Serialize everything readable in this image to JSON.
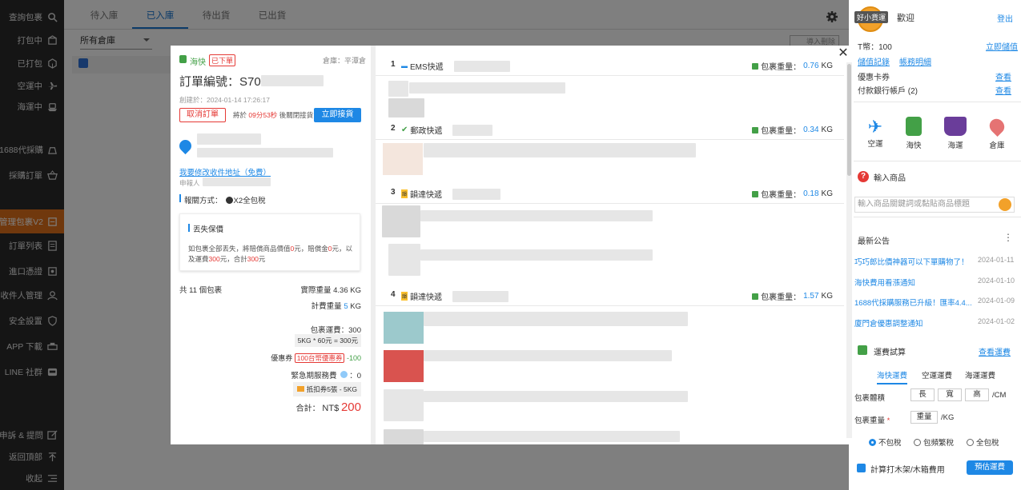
{
  "sidebar": {
    "items": [
      {
        "label": "查詢包裹",
        "icon": "search-icon"
      },
      {
        "label": "打包中",
        "icon": "box-icon"
      },
      {
        "label": "已打包",
        "icon": "package-icon"
      },
      {
        "label": "空運中",
        "icon": "plane-icon"
      },
      {
        "label": "海運中",
        "icon": "ship-icon"
      },
      {
        "label": "1688代採購",
        "icon": "shopping-icon"
      },
      {
        "label": "採購訂單",
        "icon": "basket-icon"
      },
      {
        "label": "管理包裹V2",
        "icon": "manage-icon"
      },
      {
        "label": "訂單列表",
        "icon": "list-icon"
      },
      {
        "label": "進口憑證",
        "icon": "certificate-icon"
      },
      {
        "label": "收件人管理",
        "icon": "user-icon"
      },
      {
        "label": "安全設置",
        "icon": "shield-icon"
      },
      {
        "label": "APP 下載",
        "icon": "printer-icon"
      },
      {
        "label": "LINE 社群",
        "icon": "line-icon"
      },
      {
        "label": "申訴 & 提問",
        "icon": "edit-icon"
      },
      {
        "label": "返回頂部",
        "icon": "top-arrow-icon"
      },
      {
        "label": "收起",
        "icon": "collapse-icon"
      }
    ]
  },
  "main": {
    "tabs": [
      "待入庫",
      "已入庫",
      "待出貨",
      "已出貨"
    ],
    "warehouse_select": "所有倉庫",
    "right_button": "導入刪除"
  },
  "right_panel": {
    "greeting": "歡迎",
    "badge": "好小貨運",
    "logout": "登出",
    "t_coin_label": "T幣：100",
    "t_coin_link": "立即儲值",
    "links": [
      "儲值記錄",
      "帳務明細"
    ],
    "coupon": "優惠卡券",
    "coupon_link": "查看",
    "bank": "付款銀行帳戶 (2)",
    "bank_link": "查看",
    "modes": [
      "空運",
      "海快",
      "海運",
      "倉庫"
    ],
    "help_title": "輸入商品",
    "search_placeholder": "輸入商品關鍵詞或黏貼商品標題",
    "news_title": "最新公告",
    "news": [
      {
        "title": "巧巧郎比價神器可以下單購物了！",
        "date": "2024-01-11"
      },
      {
        "title": "海快費用看漲通知",
        "date": "2024-01-10"
      },
      {
        "title": "1688代採購服務已升級！匯率4.4...",
        "date": "2024-01-09"
      },
      {
        "title": "廈門倉優惠調整通知",
        "date": "2024-01-02"
      }
    ],
    "calc_title": "運費試算",
    "calc_link": "查看運費",
    "calc_tabs": [
      "海快運費",
      "空運運費",
      "海運運費"
    ],
    "size_label": "包裹體積",
    "size_fields": [
      "長",
      "寬",
      "高"
    ],
    "size_unit": "/CM",
    "weight_label": "包裹重量",
    "weight_field": "重量",
    "weight_unit": "/KG",
    "tax_options": [
      "不包稅",
      "包頻繁稅",
      "全包稅"
    ],
    "wood_label": "計算打木架/木箱費用",
    "estimate_button": "預估運費"
  },
  "modal": {
    "mode": "海快",
    "status_badge": "已下單",
    "warehouse": "倉庫：平潭倉",
    "order_no_label": "訂單編號：",
    "order_no": "S703",
    "created": "創建於：2024-01-14 17:26:17",
    "cancel_button": "取消訂單",
    "countdown_prefix": "將於",
    "countdown": "09分53秒",
    "countdown_suffix": "後關閉接貨",
    "receive_button": "立即接貨",
    "edit_address": "我要修改收件地址（免費）",
    "applicant": "申報人",
    "customs_label": "報關方式：",
    "customs_value": "X2全包稅",
    "insurance_title": "丟失保價",
    "insurance_line1_a": "如包裹全部丟失，將賠償商品價值",
    "insurance_line1_b": "0",
    "insurance_line1_c": "元，賠償金",
    "insurance_line1_d": "0",
    "insurance_line1_e": "元，以",
    "insurance_line2_a": "及運費",
    "insurance_line2_b": "300",
    "insurance_line2_c": "元，合計",
    "insurance_line2_d": "300",
    "insurance_line2_e": "元",
    "pkg_count": "共 11 個包裹",
    "actual_weight": "實際重量 4.36 KG",
    "charge_weight_label": "計費重量",
    "charge_weight_value": "5",
    "charge_weight_unit": "KG",
    "shipping_fee": "包裹運費：300",
    "shipping_formula": "5KG * 60元 = 300元",
    "coupon_label": "優惠券",
    "coupon_tag": "100台幣優惠券",
    "coupon_value": "-100",
    "fast_fee": "緊急期服務費",
    "fast_fee_value": "：0",
    "voucher": "抵扣券5張 - 5KG",
    "total_label": "合計：",
    "total_currency": "NT$",
    "total_value": "200",
    "packages": [
      {
        "n": "1",
        "carrier": "EMS快遞",
        "weight_label": "包裹重量：",
        "weight": "0.76",
        "unit": "KG"
      },
      {
        "n": "2",
        "carrier": "郵政快遞",
        "weight_label": "包裹重量：",
        "weight": "0.34",
        "unit": "KG"
      },
      {
        "n": "3",
        "carrier": "韻達快遞",
        "weight_label": "包裹重量：",
        "weight": "0.18",
        "unit": "KG"
      },
      {
        "n": "4",
        "carrier": "韻達快遞",
        "weight_label": "包裹重量：",
        "weight": "1.57",
        "unit": "KG"
      }
    ]
  },
  "colors": {
    "accent": "#1976d2",
    "brand_orange": "#e0701a",
    "sidebar_bg": "#2b2b2b",
    "price_red": "#e53935",
    "link_blue": "#1e88e5"
  }
}
